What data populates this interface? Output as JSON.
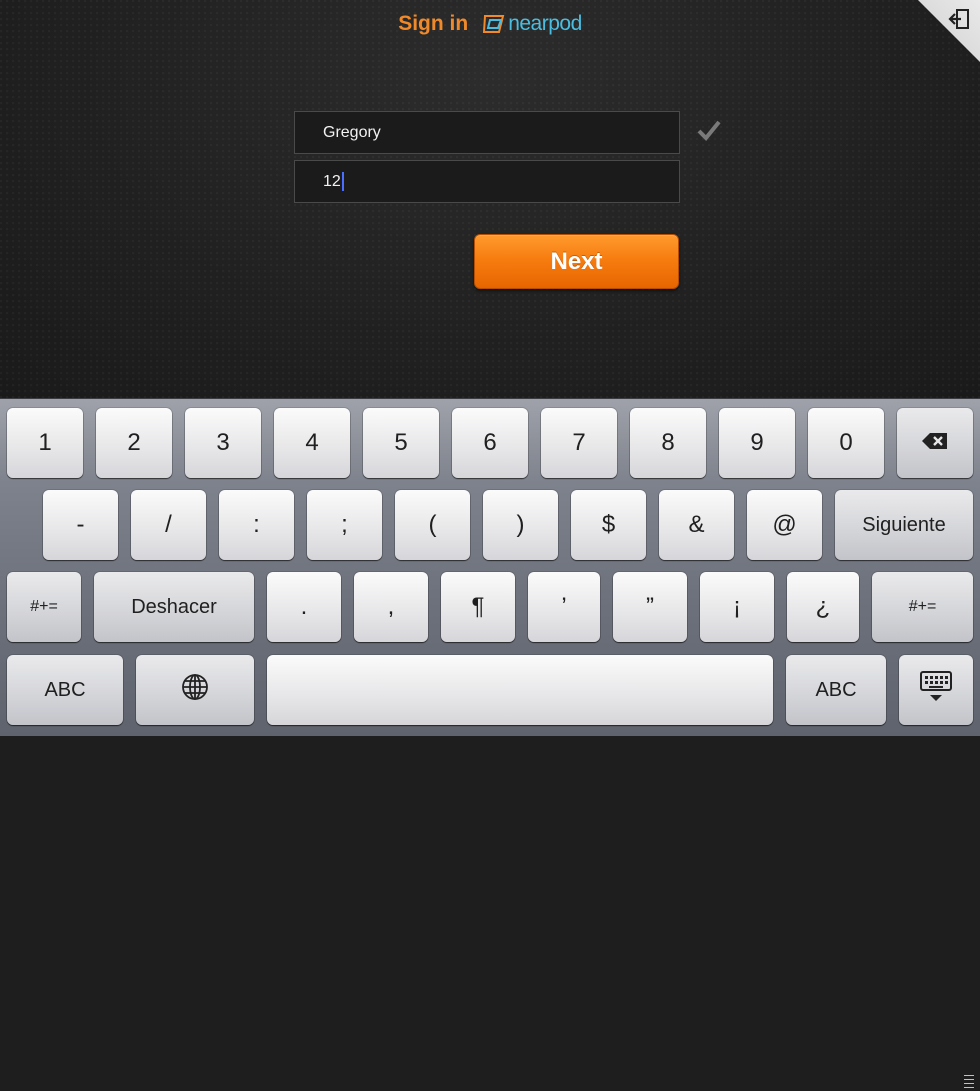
{
  "header": {
    "title": "Sign in",
    "brand": "nearpod"
  },
  "corner_action": {
    "icon": "exit-icon"
  },
  "form": {
    "name_value": "Gregory",
    "pin_value": "12",
    "name_valid_icon": "checkmark-icon",
    "next_label": "Next"
  },
  "keyboard": {
    "row1": [
      "1",
      "2",
      "3",
      "4",
      "5",
      "6",
      "7",
      "8",
      "9",
      "0"
    ],
    "row1_end_icon": "backspace-icon",
    "row2": [
      "-",
      "/",
      ":",
      ";",
      "(",
      ")",
      "$",
      "&",
      "@"
    ],
    "row2_end": "Siguiente",
    "row3_start": "#+=",
    "row3_undo": "Deshacer",
    "row3": [
      ".",
      ",",
      "¶",
      "’",
      "”",
      "¡",
      "¿"
    ],
    "row3_end": "#+=",
    "row4_abc_left": "ABC",
    "row4_globe_icon": "globe-icon",
    "row4_abc_right": "ABC",
    "row4_hide_icon": "keyboard-hide-icon"
  }
}
